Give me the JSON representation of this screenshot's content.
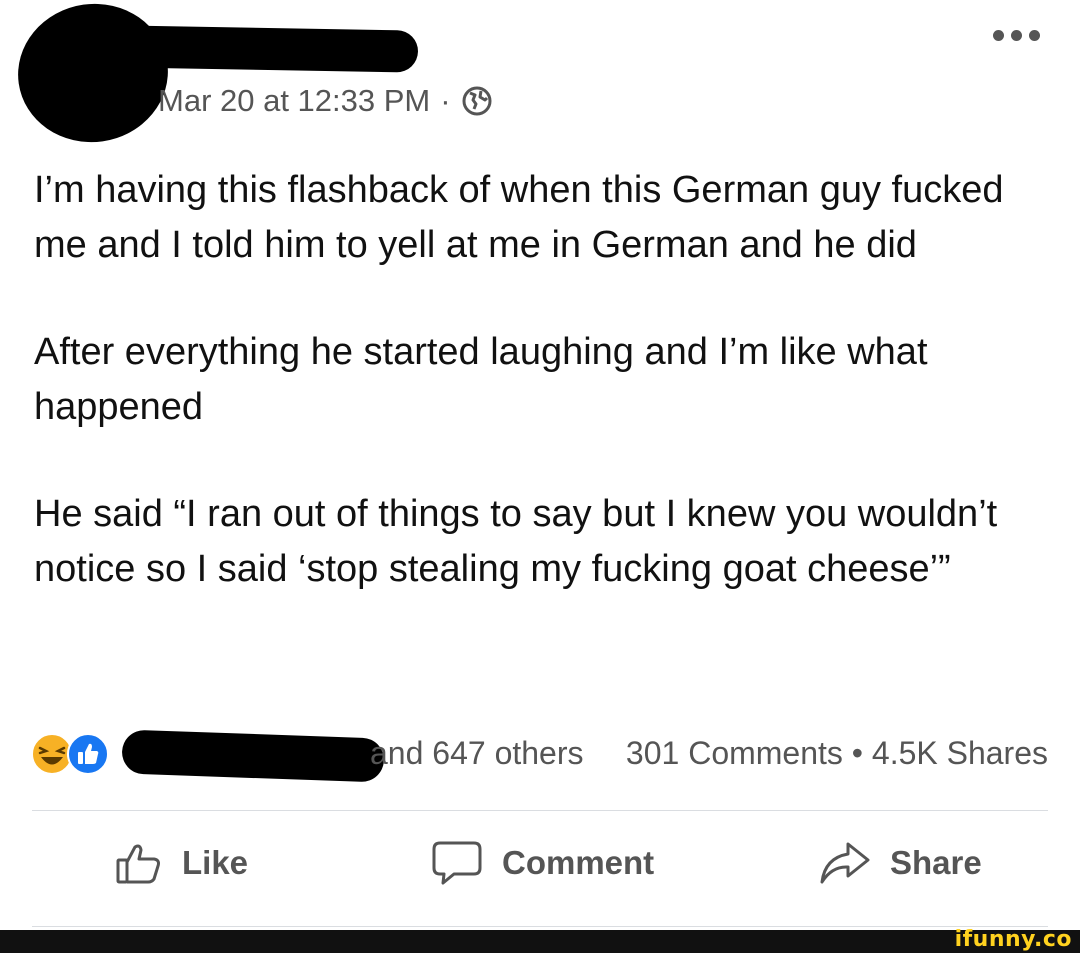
{
  "post": {
    "timestamp": "Mar 20 at 12:33 PM",
    "separator": "·",
    "paragraphs": [
      "I’m having this flashback of when this German guy fucked me and I told him to yell at me in German and he did",
      "After everything he started laughing and I’m like what happened",
      "He said “I ran out of things to say but I knew you wouldn’t notice so I said ‘stop stealing my fucking goat cheese’”"
    ]
  },
  "stats": {
    "reactions_text": "and 647 others",
    "comments_shares": "301 Comments • 4.5K Shares"
  },
  "actions": {
    "like": "Like",
    "comment": "Comment",
    "share": "Share"
  },
  "watermark": "ifunny.co",
  "colors": {
    "text": "#111111",
    "secondary": "#555555",
    "like_blue": "#1877f2",
    "haha_yellow": "#f7b125",
    "divider": "#dadde1",
    "watermark": "#ffd21f"
  },
  "icons": [
    "globe-icon",
    "more-icon",
    "haha-reaction-icon",
    "like-reaction-icon",
    "thumbs-up-icon",
    "comment-bubble-icon",
    "share-arrow-icon"
  ]
}
